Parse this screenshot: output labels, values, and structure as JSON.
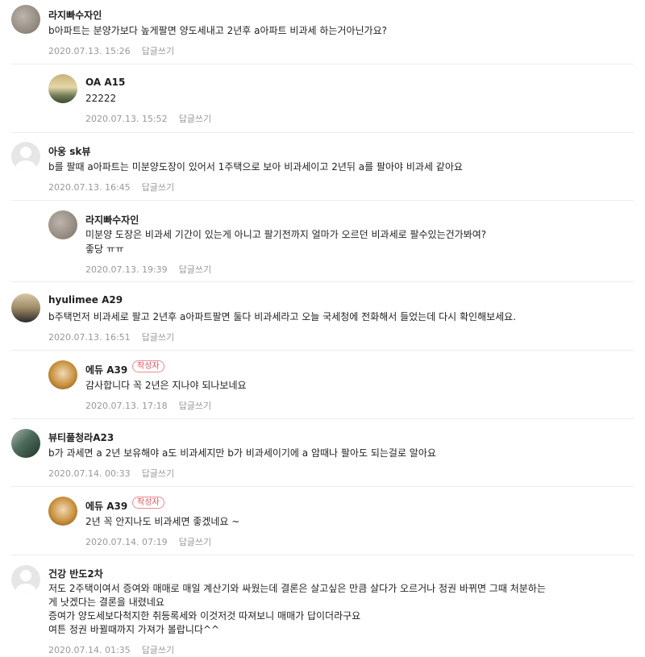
{
  "comments": [
    {
      "author": "라지빠수자인",
      "badge": "",
      "avatar": "profile-photo",
      "lines": [
        "b아파트는 분양가보다 높게팔면 양도세내고 2년후 a아파트 비과세 하는거아닌가요?"
      ],
      "date": "2020.07.13. 15:26",
      "reply_label": "답글쓰기"
    },
    {
      "author": "OA A15",
      "badge": "",
      "avatar": "profile-photo",
      "lines": [
        "22222"
      ],
      "date": "2020.07.13. 15:52",
      "reply_label": "답글쓰기"
    },
    {
      "author": "아웅 sk뷰",
      "badge": "",
      "avatar": "default-profile",
      "lines": [
        "b를 팔때 a아파트는 미분양도장이 있어서 1주택으로 보아 비과세이고 2년뒤 a를 팔아야 비과세 같아요"
      ],
      "date": "2020.07.13. 16:45",
      "reply_label": "답글쓰기"
    },
    {
      "author": "라지빠수자인",
      "badge": "",
      "avatar": "profile-photo",
      "lines": [
        "미분양 도장은 비과세 기간이 있는게 아니고 팔기전까지 얼마가 오르던 비과세로 팔수있는건가봐여?",
        "좋당 ㅠㅠ"
      ],
      "date": "2020.07.13. 19:39",
      "reply_label": "답글쓰기"
    },
    {
      "author": "hyulimee A29",
      "badge": "",
      "avatar": "profile-photo",
      "lines": [
        "b주택먼저 비과세로 팔고 2년후 a아파트팔면 둘다 비과세라고 오늘 국세청에 전화해서 들었는데 다시 확인해보세요."
      ],
      "date": "2020.07.13. 16:51",
      "reply_label": "답글쓰기"
    },
    {
      "author": "에듀 A39",
      "badge": "작성자",
      "avatar": "profile-photo",
      "lines": [
        "감사합니다 꼭 2년은 지나야 되나보네요"
      ],
      "date": "2020.07.13. 17:18",
      "reply_label": "답글쓰기"
    },
    {
      "author": "뷰티풀청라A23",
      "badge": "",
      "avatar": "profile-photo",
      "lines": [
        "b가 과세면 a 2년 보유해야 a도 비과세지만 b가 비과세이기에 a 암때나 팔아도 되는걸로 알아요"
      ],
      "date": "2020.07.14. 00:33",
      "reply_label": "답글쓰기"
    },
    {
      "author": "에듀 A39",
      "badge": "작성자",
      "avatar": "profile-photo",
      "lines": [
        "2년 꼭 안지나도 비과세면 좋겠네요 ~"
      ],
      "date": "2020.07.14. 07:19",
      "reply_label": "답글쓰기"
    },
    {
      "author": "건강 반도2차",
      "badge": "",
      "avatar": "default-profile",
      "lines": [
        "저도 2주택이여서 증여와 매매로 매일 계산기와 싸웠는데 결론은 살고싶은 만큼 살다가 오르거나 정권 바뀌면 그때 처분하는",
        "게 낫겠다는 결론을 내렸네요",
        "증여가 양도세보다척지한 취등록세와 이것저것 따져보니 매매가 답이더라구요",
        "여튼 정권 바뀔때까지 가져가 볼랍니다^^"
      ],
      "date": "2020.07.14. 01:35",
      "reply_label": "답글쓰기"
    }
  ]
}
